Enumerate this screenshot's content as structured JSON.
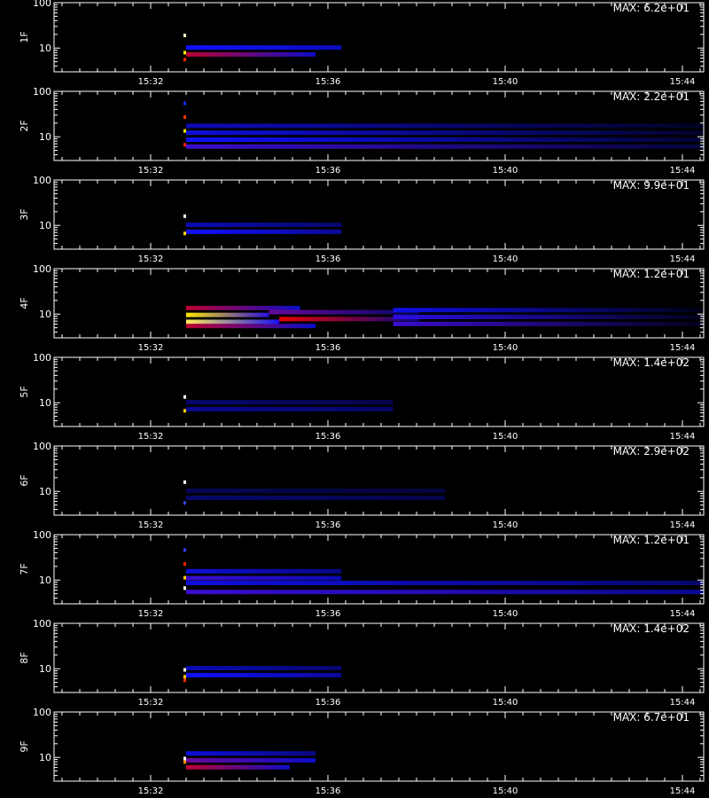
{
  "chart_data": {
    "type": "heatmap",
    "x_tick_labels": [
      "15:32",
      "15:36",
      "15:40",
      "15:44"
    ],
    "y_tick_labels": [
      "100",
      "10"
    ],
    "y_scale": "log",
    "colormap": [
      "#000000",
      "#0010ff",
      "#ff0000",
      "#ffff00",
      "#ffffff"
    ],
    "panels": [
      {
        "label": "1F",
        "max_text": "MAX: 6.2e+01",
        "spike": [
          [
            "#fff8c0",
            0.45
          ],
          [
            "#ffee00",
            0.2
          ],
          [
            "#ff2200",
            0.1
          ]
        ],
        "bands": [
          {
            "bin": 0.2,
            "intensity": 0.55,
            "from": 0.0,
            "to": 0.25,
            "fade": 0.5
          },
          {
            "bin": 0.3,
            "intensity": 0.35,
            "from": 0.0,
            "to": 0.3,
            "fade": 0.75
          }
        ]
      },
      {
        "label": "2F",
        "max_text": "MAX: 2.2e+01",
        "spike": [
          [
            "#ff1a00",
            0.15
          ],
          [
            "#ffdd00",
            0.35
          ],
          [
            "#ff3300",
            0.55
          ],
          [
            "#1030ff",
            0.75
          ]
        ],
        "bands": [
          {
            "bin": 0.15,
            "intensity": 0.4,
            "from": 0.0,
            "to": 1.0,
            "fade": 0.2
          },
          {
            "bin": 0.25,
            "intensity": 0.35,
            "from": 0.0,
            "to": 1.0,
            "fade": 0.2
          },
          {
            "bin": 0.35,
            "intensity": 0.3,
            "from": 0.0,
            "to": 1.0,
            "fade": 0.2
          },
          {
            "bin": 0.45,
            "intensity": 0.25,
            "from": 0.0,
            "to": 1.0,
            "fade": 0.2
          }
        ]
      },
      {
        "label": "3F",
        "max_text": "MAX: 9.9e+01",
        "spike": [
          [
            "#ffffff",
            0.4
          ],
          [
            "#ffd000",
            0.15
          ]
        ],
        "bands": [
          {
            "bin": 0.2,
            "intensity": 0.35,
            "from": 0.0,
            "to": 0.3,
            "fade": 0.6
          },
          {
            "bin": 0.3,
            "intensity": 0.25,
            "from": 0.0,
            "to": 0.3,
            "fade": 0.6
          }
        ]
      },
      {
        "label": "4F",
        "max_text": "MAX: 1.2e+01",
        "spike": [],
        "bands": [
          {
            "bin": 0.18,
            "intensity": 0.9,
            "from": 0.0,
            "to": 0.18,
            "fade": 0.4
          },
          {
            "bin": 0.28,
            "intensity": 0.85,
            "from": 0.0,
            "to": 0.16,
            "fade": 0.45
          },
          {
            "bin": 0.12,
            "intensity": 0.55,
            "from": 0.0,
            "to": 0.25,
            "fade": 0.5
          },
          {
            "bin": 0.38,
            "intensity": 0.55,
            "from": 0.0,
            "to": 0.22,
            "fade": 0.5
          },
          {
            "bin": 0.22,
            "intensity": 0.6,
            "from": 0.18,
            "to": 0.45,
            "fade": 0.3
          },
          {
            "bin": 0.32,
            "intensity": 0.45,
            "from": 0.16,
            "to": 0.45,
            "fade": 0.3
          },
          {
            "bin": 0.15,
            "intensity": 0.4,
            "from": 0.4,
            "to": 1.0,
            "fade": 0.1
          },
          {
            "bin": 0.25,
            "intensity": 0.38,
            "from": 0.4,
            "to": 1.0,
            "fade": 0.1
          },
          {
            "bin": 0.35,
            "intensity": 0.32,
            "from": 0.4,
            "to": 1.0,
            "fade": 0.1
          }
        ]
      },
      {
        "label": "5F",
        "max_text": "MAX: 1.4e+02",
        "spike": [
          [
            "#ffffff",
            0.35
          ],
          [
            "#ffd000",
            0.15
          ]
        ],
        "bands": [
          {
            "bin": 0.2,
            "intensity": 0.2,
            "from": 0.0,
            "to": 0.4,
            "fade": 0.7
          },
          {
            "bin": 0.3,
            "intensity": 0.15,
            "from": 0.0,
            "to": 0.4,
            "fade": 0.7
          }
        ]
      },
      {
        "label": "6F",
        "max_text": "MAX: 2.9e+02",
        "spike": [
          [
            "#ffffff",
            0.4
          ],
          [
            "#3040ff",
            0.1
          ]
        ],
        "bands": [
          {
            "bin": 0.2,
            "intensity": 0.15,
            "from": 0.0,
            "to": 0.5,
            "fade": 0.7
          },
          {
            "bin": 0.3,
            "intensity": 0.12,
            "from": 0.0,
            "to": 0.5,
            "fade": 0.7
          }
        ]
      },
      {
        "label": "7F",
        "max_text": "MAX: 1.2e+01",
        "spike": [
          [
            "#ffffff",
            0.15
          ],
          [
            "#ffcc00",
            0.3
          ],
          [
            "#ff2000",
            0.5
          ],
          [
            "#3040ff",
            0.7
          ]
        ],
        "bands": [
          {
            "bin": 0.12,
            "intensity": 0.4,
            "from": 0.0,
            "to": 1.0,
            "fade": 0.5
          },
          {
            "bin": 0.25,
            "intensity": 0.3,
            "from": 0.0,
            "to": 1.0,
            "fade": 0.5
          },
          {
            "bin": 0.32,
            "intensity": 0.4,
            "from": 0.0,
            "to": 0.3,
            "fade": 0.6
          },
          {
            "bin": 0.42,
            "intensity": 0.3,
            "from": 0.0,
            "to": 0.3,
            "fade": 0.6
          }
        ]
      },
      {
        "label": "8F",
        "max_text": "MAX: 1.4e+02",
        "spike": [
          [
            "#ffffff",
            0.25
          ],
          [
            "#ffcc00",
            0.15
          ],
          [
            "#ff3000",
            0.1
          ]
        ],
        "bands": [
          {
            "bin": 0.2,
            "intensity": 0.35,
            "from": 0.0,
            "to": 0.3,
            "fade": 0.6
          },
          {
            "bin": 0.3,
            "intensity": 0.25,
            "from": 0.0,
            "to": 0.3,
            "fade": 0.6
          }
        ]
      },
      {
        "label": "9F",
        "max_text": "MAX: 6.7e+01",
        "spike": [
          [
            "#ffffff",
            0.25
          ],
          [
            "#ff8800",
            0.2
          ]
        ],
        "bands": [
          {
            "bin": 0.15,
            "intensity": 0.55,
            "from": 0.0,
            "to": 0.2,
            "fade": 0.5
          },
          {
            "bin": 0.25,
            "intensity": 0.45,
            "from": 0.0,
            "to": 0.25,
            "fade": 0.6
          },
          {
            "bin": 0.35,
            "intensity": 0.3,
            "from": 0.0,
            "to": 0.25,
            "fade": 0.6
          }
        ]
      }
    ]
  }
}
